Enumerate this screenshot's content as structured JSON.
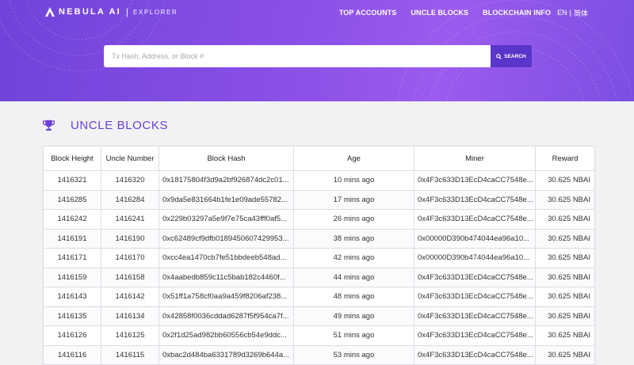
{
  "header": {
    "brand": "NEBULA AI",
    "brand_sub": "EXPLORER",
    "nav": [
      "TOP ACCOUNTS",
      "UNCLE BLOCKS",
      "BLOCKCHAIN INFO"
    ],
    "lang_en": "EN",
    "lang_sep": "|",
    "lang_zh": "简体"
  },
  "search": {
    "placeholder": "Tx Hash, Address, or Block #",
    "button_label": "SEARCH"
  },
  "page": {
    "title": "UNCLE BLOCKS"
  },
  "table": {
    "columns": [
      "Block Height",
      "Uncle Number",
      "Block Hash",
      "Age",
      "Miner",
      "Reward"
    ],
    "rows": [
      [
        "1416321",
        "1416320",
        "0x18175804f3d9a2bf926874dc2c01...",
        "10 mins ago",
        "0x4F3c633D13EcD4caCC7548e...",
        "30.625 NBAI"
      ],
      [
        "1416285",
        "1416284",
        "0x9da5e831664b1fe1e09ade55782...",
        "17 mins ago",
        "0x4F3c633D13EcD4caCC7548e...",
        "30.625 NBAI"
      ],
      [
        "1416242",
        "1416241",
        "0x229b03297a5e9f7e75ca43fff0af5...",
        "26 mins ago",
        "0x4F3c633D13EcD4caCC7548e...",
        "30.625 NBAI"
      ],
      [
        "1416191",
        "1416190",
        "0xc62489cf9dfb0189450607429953...",
        "38 mins ago",
        "0x00000D390b474044ea96a10...",
        "30.625 NBAI"
      ],
      [
        "1416171",
        "1416170",
        "0xcc4ea1470cb7fe51bbdeeb548ad...",
        "42 mins ago",
        "0x00000D390b474044ea96a10...",
        "30.625 NBAI"
      ],
      [
        "1416159",
        "1416158",
        "0x4aabedb859c11c5bab182c4460f...",
        "44 mins ago",
        "0x4F3c633D13EcD4caCC7548e...",
        "30.625 NBAI"
      ],
      [
        "1416143",
        "1416142",
        "0x51ff1a758cf0aa9a459f8206af238...",
        "48 mins ago",
        "0x4F3c633D13EcD4caCC7548e...",
        "30.625 NBAI"
      ],
      [
        "1416135",
        "1416134",
        "0x42858f0036cddad6287f5f954ca7f...",
        "49 mins ago",
        "0x4F3c633D13EcD4caCC7548e...",
        "30.625 NBAI"
      ],
      [
        "1416126",
        "1416125",
        "0x2f1d25ad982bb60556cb54e9ddc...",
        "51 mins ago",
        "0x4F3c633D13EcD4caCC7548e...",
        "30.625 NBAI"
      ],
      [
        "1416116",
        "1416115",
        "0xbac2d484ba6331789d3269b644a...",
        "53 mins ago",
        "0x4F3c633D13EcD4caCC7548e...",
        "30.625 NBAI"
      ]
    ]
  },
  "colors": {
    "accent": "#6a3fd6",
    "header_gradient_start": "#6f44d9",
    "header_gradient_end": "#9b5bee",
    "search_button": "#5b35c9"
  },
  "icons": {
    "logo": "nebula-logo-icon",
    "search": "search-icon",
    "section": "trophy-icon"
  }
}
